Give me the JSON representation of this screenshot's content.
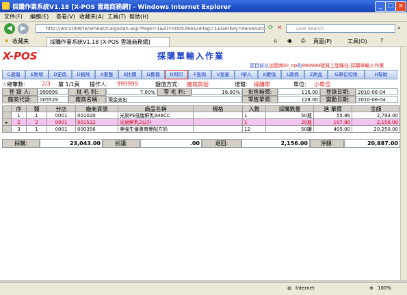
{
  "window": {
    "title": "採購作業系統V1.18 [X-POS 雲端商務網] - Windows Internet Explorer"
  },
  "menu": [
    "文件(F)",
    "編輯(E)",
    "查看(V)",
    "收藏夹(A)",
    "工具(T)",
    "帮助(H)"
  ],
  "address": {
    "url": "http://win2008/te/ameat/Caigodan.asp?Page=1&dl=0005294&nFlag=1&GetKey=FalseAutoExec=Tr"
  },
  "search": {
    "placeholder": "Live Search"
  },
  "tabbar": {
    "favorites": "收藏夹",
    "tab_title": "採購作業系統V1.18 [X-POS 雲端商務網]",
    "page_menu": "頁面(P)",
    "tools_menu": "工具(O)"
  },
  "app": {
    "logo": "X-POS",
    "title": "採購單輸入作業",
    "login_prefix": "您目前以",
    "login_user": "加盟商ikl_np",
    "login_mid": "的",
    "login_id": "999999號員工登錄在:",
    "login_page": "採購單輸入作業"
  },
  "toolbar": [
    "C選檔",
    "E新增",
    "D更改",
    "D刪除",
    "A重整",
    "B比價",
    "G舊檔",
    "R列印",
    "F查詢",
    "V查量",
    "I帶入",
    "K鍵值",
    "L廠商",
    "Z商品",
    "G單位切換",
    "H幫助"
  ],
  "status": {
    "total_label": "☆總筆數:",
    "total_value": "2/3",
    "page_text": "第 1/1頁",
    "operator_label": "操作人:",
    "operator_value": "999999",
    "keymode_label": "鍵值方式:",
    "keymode_value": "廠商貨號",
    "increase_label": "增幫:",
    "increase_value": "採購單",
    "unit_label": "單位:",
    "unit_value": "小單位"
  },
  "form": {
    "recorder_label": "登 錄 人:",
    "recorder_value": "999999",
    "gross_label": "批 毛 利:",
    "gross_value": "7.00%",
    "zero_gross_label": "零 毛 利:",
    "zero_gross_value": "16.00%",
    "batch_price_label": "批售箱價:",
    "batch_price_value": "116.00",
    "login_date_label": "登錄日期:",
    "login_date_value": "2010-06-04",
    "vendor_code_label": "廠商代號:",
    "vendor_code_value": "005529",
    "vendor_name_label": "廠商名稱:",
    "vendor_name_value": "現金支出",
    "retail_price_label": "零售單價:",
    "retail_price_value": "128.00",
    "change_date_label": "變動日期:",
    "change_date_value": "2010-06-04"
  },
  "grid": {
    "headers": [
      "序",
      "類",
      "分店",
      "廠商貨號",
      "商品名稱",
      "規格",
      "入數",
      "採購數量",
      "進 單價",
      "金額"
    ],
    "rows": [
      {
        "seq": "1",
        "cat": "1",
        "branch": "0001",
        "code": "001020",
        "name": "光泉PE低脂鮮乳946CC",
        "spec": "",
        "qty": "1",
        "order": "50瓶",
        "price": "55.86",
        "amount": "2,793.00"
      },
      {
        "seq": "2",
        "cat": "2",
        "branch": "0001",
        "code": "001512",
        "name": "光泉鮮乳2公升",
        "spec": "",
        "qty": "1",
        "order": "20瓶",
        "price": "107.80",
        "amount": "2,156.00"
      },
      {
        "seq": "3",
        "cat": "1",
        "branch": "0001",
        "code": "000356",
        "name": "美強生優惠育嬰配方奶",
        "spec": "",
        "qty": "12",
        "order": "50罐",
        "price": "405.00",
        "amount": "20,250.00"
      }
    ]
  },
  "totals": {
    "purchase_label": "採購:",
    "purchase_value": "23,043.00",
    "discount_label": "折讓:",
    "discount_value": ".00",
    "return_label": "退回:",
    "return_value": "2,156.00",
    "net_label": "淨額:",
    "net_value": "20,887.00"
  },
  "statusbar": {
    "zone": "Internet",
    "zoom": "100%"
  }
}
